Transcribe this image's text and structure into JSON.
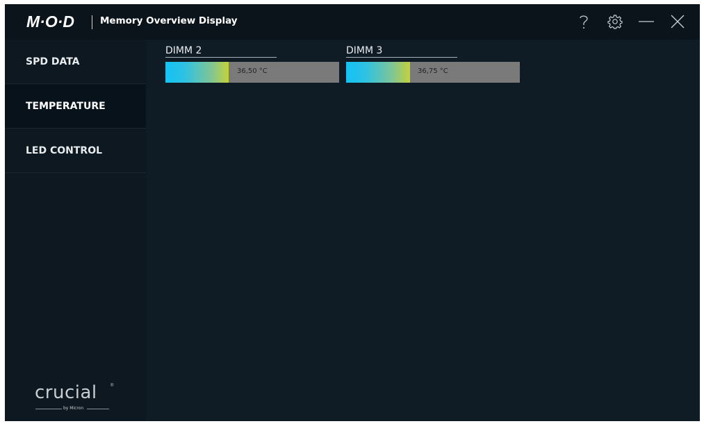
{
  "app": {
    "logo": "M·O·D",
    "title": "Memory Overview Display"
  },
  "titlebar": {
    "help_icon": "question-icon",
    "settings_icon": "gear-icon",
    "minimize_icon": "minimize-icon",
    "close_icon": "close-icon"
  },
  "sidebar": {
    "items": [
      {
        "label": "SPD DATA",
        "active": false
      },
      {
        "label": "TEMPERATURE",
        "active": true
      },
      {
        "label": "LED CONTROL",
        "active": false
      }
    ],
    "brand": {
      "name": "crucial",
      "mark": "®",
      "byline": "by Micron"
    }
  },
  "main": {
    "dimms": [
      {
        "label": "DIMM 2",
        "temperature": "36,50 °C",
        "level": 0.365
      },
      {
        "label": "DIMM 3",
        "temperature": "36,75 °C",
        "level": 0.3675
      }
    ]
  },
  "colors": {
    "background": "#0f1c26",
    "titlebar": "#0b141b",
    "bar_track": "#7a7a7a",
    "gradient_start": "#13c3f3",
    "gradient_end": "#c4d23a"
  }
}
